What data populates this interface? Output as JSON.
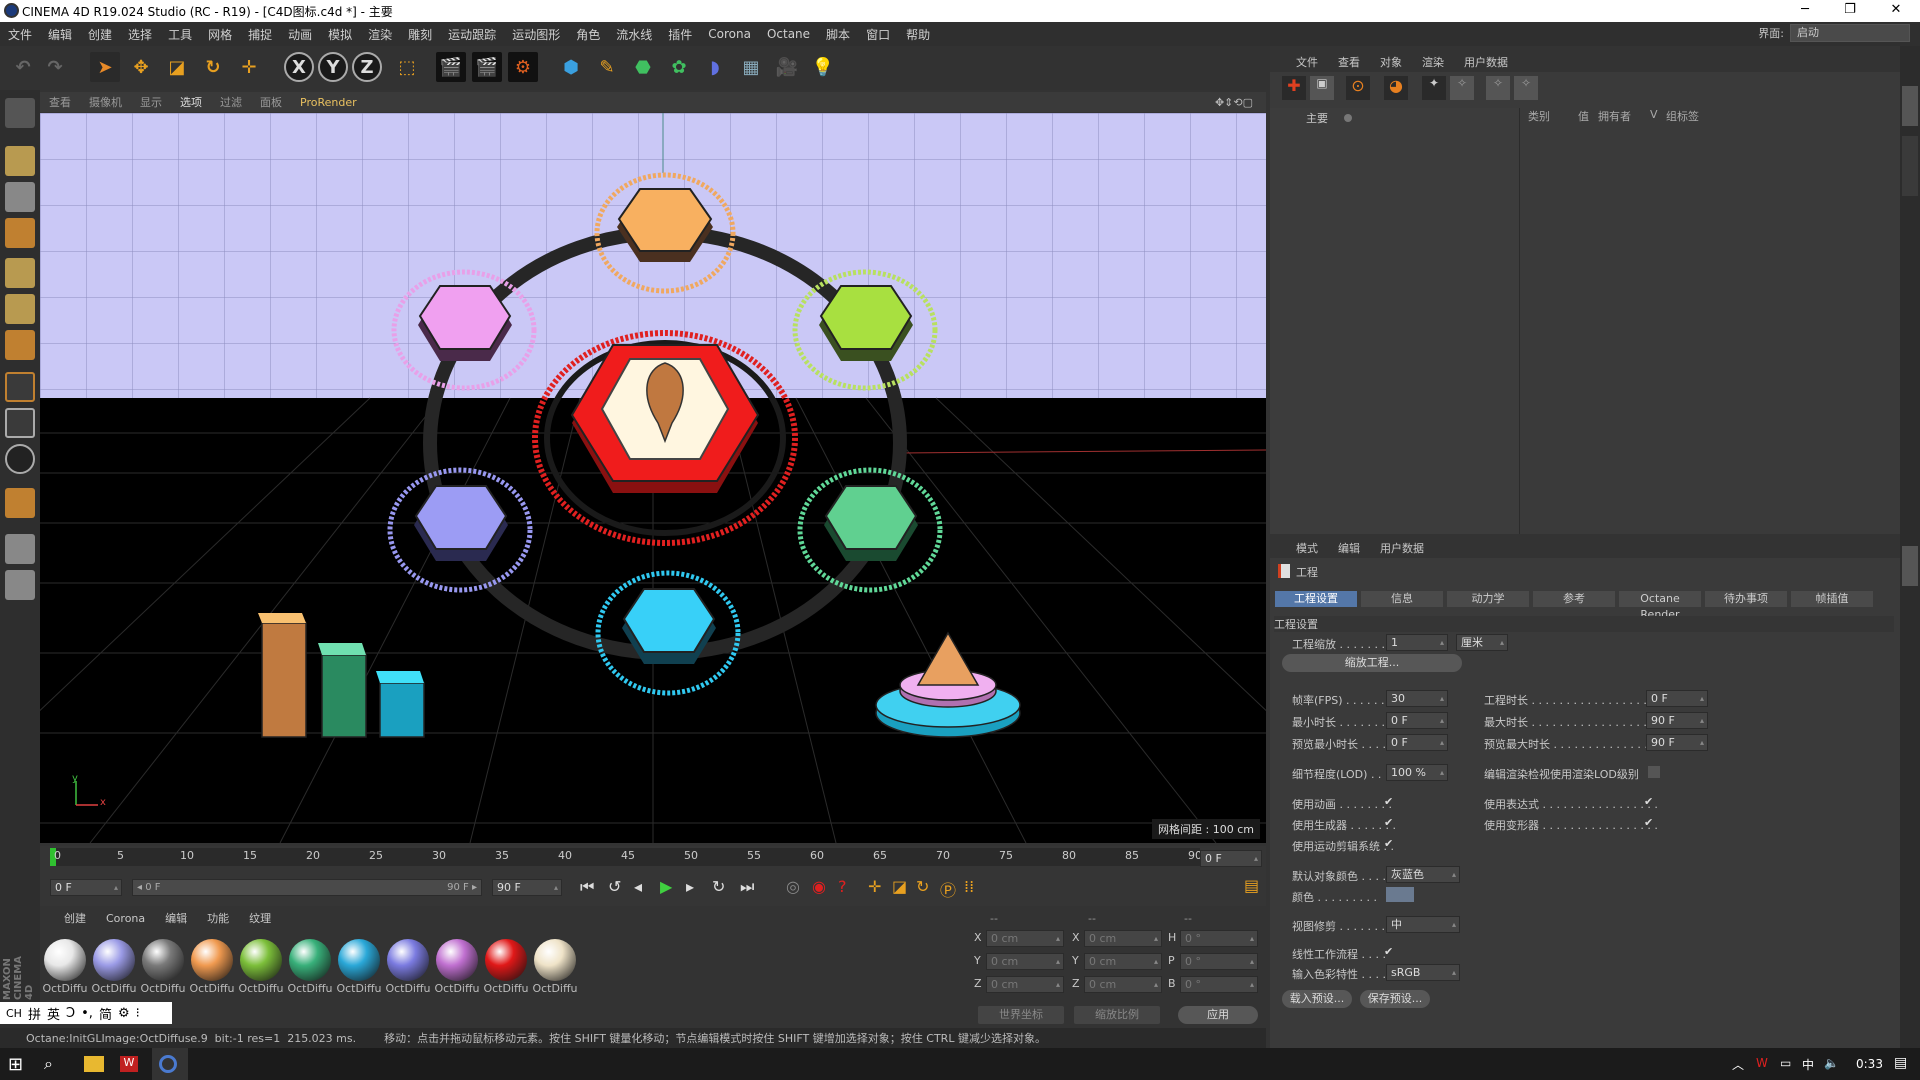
{
  "window": {
    "title": "CINEMA 4D R19.024 Studio (RC - R19) - [C4D图标.c4d *] - 主要",
    "min": "─",
    "max": "❐",
    "close": "✕"
  },
  "menu": {
    "items": [
      "文件",
      "编辑",
      "创建",
      "选择",
      "工具",
      "网格",
      "捕捉",
      "动画",
      "模拟",
      "渲染",
      "雕刻",
      "运动跟踪",
      "运动图形",
      "角色",
      "流水线",
      "插件",
      "Corona",
      "Octane",
      "脚本",
      "窗口",
      "帮助"
    ],
    "layout_label": "界面:",
    "layout_value": "启动"
  },
  "toolbar": {
    "axis_x": "X",
    "axis_y": "Y",
    "axis_z": "Z"
  },
  "viewport": {
    "menu": [
      "查看",
      "摄像机",
      "显示",
      "选项",
      "过滤",
      "面板",
      "ProRender"
    ],
    "grid_spacing": "网格间距 : 100 cm",
    "axis_x": "x",
    "axis_y": "y"
  },
  "timeline": {
    "ticks": [
      "0",
      "5",
      "10",
      "15",
      "20",
      "25",
      "30",
      "35",
      "40",
      "45",
      "50",
      "55",
      "60",
      "65",
      "70",
      "75",
      "80",
      "85",
      "90"
    ],
    "frame_field": "0 F",
    "start": "0 F",
    "slider_start": "◂ 0 F",
    "slider_end": "90 F ▸",
    "end_field": "90 F",
    "current": "0 F"
  },
  "materials": {
    "menu": [
      "创建",
      "Corona",
      "编辑",
      "功能",
      "纹理"
    ],
    "items": [
      {
        "name": "OctDiffu",
        "color": "#e8e8e8"
      },
      {
        "name": "OctDiffu",
        "color": "#9b9be6"
      },
      {
        "name": "OctDiffu",
        "color": "#7a7a7a"
      },
      {
        "name": "OctDiffu",
        "color": "#f09a50"
      },
      {
        "name": "OctDiffu",
        "color": "#7cbf3a"
      },
      {
        "name": "OctDiffu",
        "color": "#38b07a"
      },
      {
        "name": "OctDiffu",
        "color": "#2aa8d8"
      },
      {
        "name": "OctDiffu",
        "color": "#7b7be0"
      },
      {
        "name": "OctDiffu",
        "color": "#c070d0"
      },
      {
        "name": "OctDiffu",
        "color": "#e01818"
      },
      {
        "name": "OctDiffu",
        "color": "#efe3c8"
      }
    ]
  },
  "coords": {
    "header": [
      "--",
      "--",
      "--"
    ],
    "rows": [
      {
        "a": "X",
        "av": "0 cm",
        "b": "X",
        "bv": "0 cm",
        "c": "H",
        "cv": "0 °"
      },
      {
        "a": "Y",
        "av": "0 cm",
        "b": "Y",
        "bv": "0 cm",
        "c": "P",
        "cv": "0 °"
      },
      {
        "a": "Z",
        "av": "0 cm",
        "b": "Z",
        "bv": "0 cm",
        "c": "B",
        "cv": "0 °"
      }
    ],
    "world": "世界坐标",
    "scale": "缩放比例",
    "apply": "应用"
  },
  "ime": [
    "CH",
    "拼",
    "英",
    "Ͻ",
    "•,",
    "简",
    "⚙",
    "⁝"
  ],
  "status": "Octane:InitGLImage:OctDiffuse.9  bit:-1 res=1  215.023 ms.        移动：点击并拖动鼠标移动元素。按住 SHIFT 键量化移动；节点编辑模式时按住 SHIFT 键增加选择对象；按住 CTRL 键减少选择对象。",
  "objmgr": {
    "menu": [
      "文件",
      "查看",
      "对象",
      "渲染",
      "用户数据"
    ],
    "root": "主要",
    "cols": [
      "类别",
      "值",
      "拥有者",
      "V",
      "组标签"
    ]
  },
  "attr": {
    "menu": [
      "模式",
      "编辑",
      "用户数据"
    ],
    "title": "工程",
    "tabs": [
      "工程设置",
      "信息",
      "动力学",
      "参考",
      "Octane Render",
      "待办事项",
      "帧插值"
    ],
    "section": "工程设置",
    "scale_label": "工程缩放 . . . . . . . .",
    "scale_value": "1",
    "scale_unit": "厘米",
    "scale_btn": "缩放工程...",
    "fps_label": "帧率(FPS) . . . . . . .",
    "fps_value": "30",
    "mintime_label": "最小时长 . . . . . . . .",
    "mintime_value": "0 F",
    "pmin_label": "预览最小时长 . . . . .",
    "pmin_value": "0 F",
    "projtime_label": "工程时长 . . . . . . . . . . . . . . . . . .",
    "projtime_value": "0 F",
    "maxtime_label": "最大时长 . . . . . . . . . . . . . . . . . .",
    "maxtime_value": "90 F",
    "pmax_label": "预览最大时长 . . . . . . . . . . . . . . .",
    "pmax_value": "90 F",
    "lod_label": "细节程度(LOD) . . . .",
    "lod_value": "100 %",
    "lod_render_label": "编辑渲染检视使用渲染LOD级别",
    "anim_label": "使用动画 . . . . . . . .",
    "gen_label": "使用生成器 . . . . . . .",
    "mograph_label": "使用运动剪辑系统 . .",
    "expr_label": "使用表达式 . . . . . . . . . . . . . . . . .",
    "deform_label": "使用变形器 . . . . . . . . . . . . . . . . .",
    "objcolor_label": "默认对象颜色 . . . .",
    "objcolor_value": "灰蓝色",
    "color_label": "颜色 . . . . . . . . . . . . . .",
    "clip_label": "视图修剪 . . . . . . . .",
    "clip_value": "中",
    "linear_label": "线性工作流程 . . . .",
    "profile_label": "输入色彩特性 . . . .",
    "profile_value": "sRGB",
    "load_btn": "载入预设...",
    "save_btn": "保存预设..."
  },
  "taskbar": {
    "time": "0:33"
  }
}
